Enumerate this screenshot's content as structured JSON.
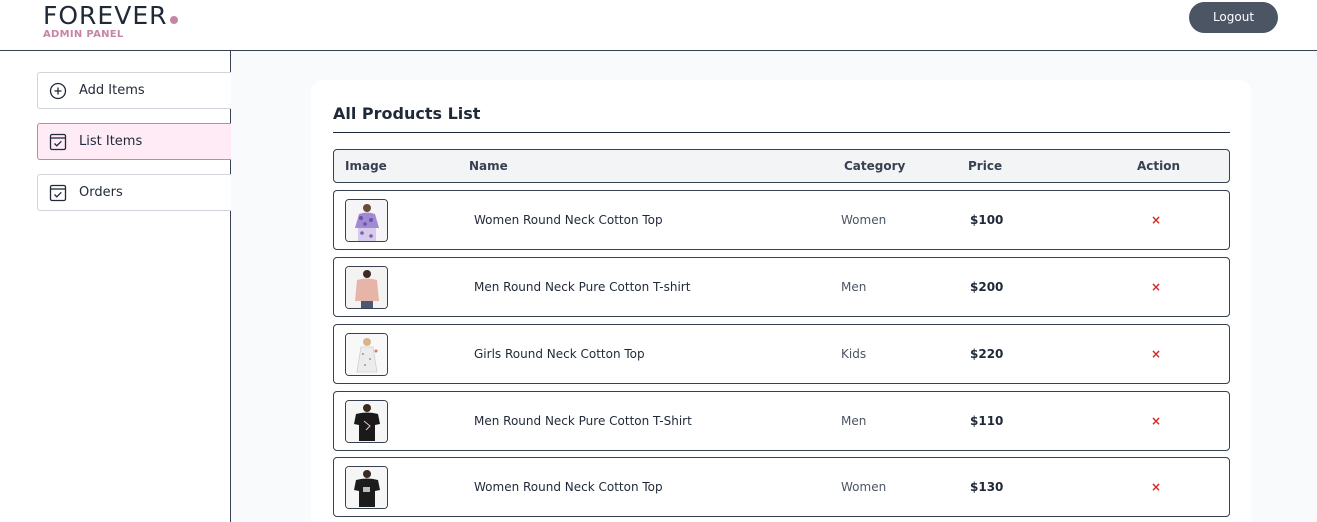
{
  "brand": {
    "name": "FOREVER",
    "subtitle": "ADMIN PANEL",
    "accent_color": "#c586a5"
  },
  "header": {
    "logout_label": "Logout"
  },
  "sidebar": {
    "items": [
      {
        "label": "Add Items",
        "icon": "plus-circle-icon",
        "active": false
      },
      {
        "label": "List Items",
        "icon": "list-check-icon",
        "active": true
      },
      {
        "label": "Orders",
        "icon": "orders-check-icon",
        "active": false
      }
    ]
  },
  "main": {
    "title": "All Products List",
    "columns": [
      "Image",
      "Name",
      "Category",
      "Price",
      "Action"
    ],
    "products": [
      {
        "name": "Women Round Neck Cotton Top",
        "category": "Women",
        "price": "$100",
        "action": "×",
        "image": "product-thumbnail-women-floral-top"
      },
      {
        "name": "Men Round Neck Pure Cotton T-shirt",
        "category": "Men",
        "price": "$200",
        "action": "×",
        "image": "product-thumbnail-men-pink-shirt"
      },
      {
        "name": "Girls Round Neck Cotton Top",
        "category": "Kids",
        "price": "$220",
        "action": "×",
        "image": "product-thumbnail-girls-white-dress"
      },
      {
        "name": "Men Round Neck Pure Cotton T-Shirt",
        "category": "Men",
        "price": "$110",
        "action": "×",
        "image": "product-thumbnail-men-black-tee"
      },
      {
        "name": "Women Round Neck Cotton Top",
        "category": "Women",
        "price": "$130",
        "action": "×",
        "image": "product-thumbnail-men-black-tee-2"
      }
    ]
  }
}
